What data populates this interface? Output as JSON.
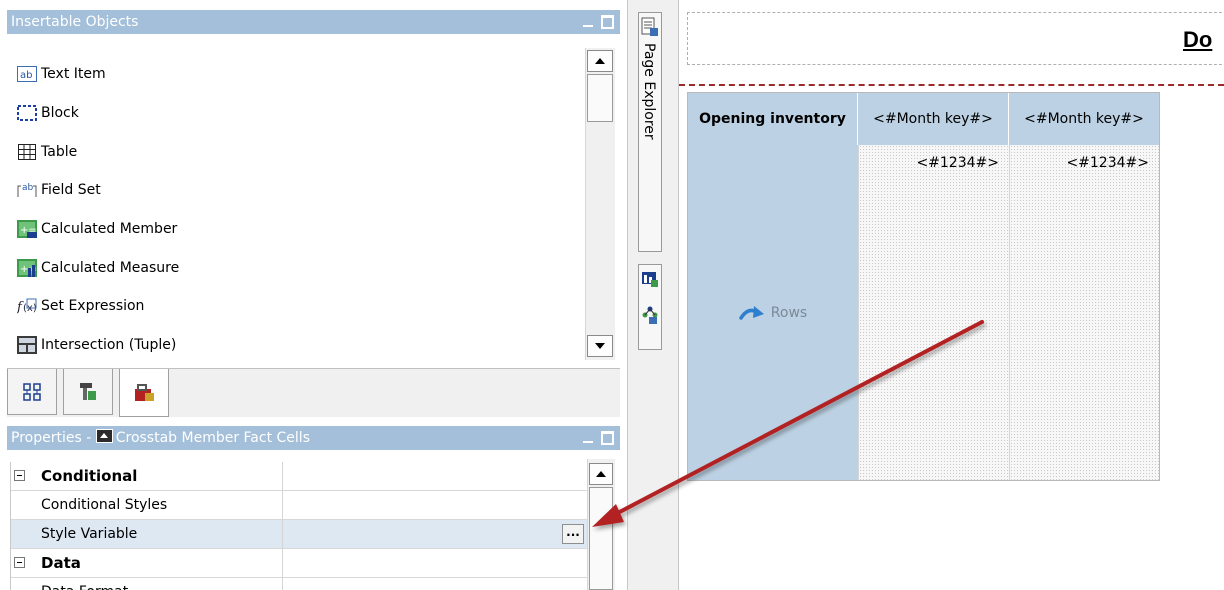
{
  "insertable_objects": {
    "title": "Insertable Objects",
    "items": [
      {
        "label": "Text Item",
        "icon": "text-item-icon"
      },
      {
        "label": "Block",
        "icon": "block-icon"
      },
      {
        "label": "Table",
        "icon": "table-icon"
      },
      {
        "label": "Field Set",
        "icon": "field-set-icon"
      },
      {
        "label": "Calculated Member",
        "icon": "calculated-member-icon"
      },
      {
        "label": "Calculated Measure",
        "icon": "calculated-measure-icon"
      },
      {
        "label": "Set Expression",
        "icon": "set-expression-icon"
      },
      {
        "label": "Intersection (Tuple)",
        "icon": "intersection-icon"
      }
    ],
    "tabs": [
      "source-tab-icon",
      "data-items-tab-icon",
      "toolbox-tab-icon"
    ]
  },
  "properties": {
    "title_prefix": "Properties - ",
    "title_object": "Crosstab Member Fact Cells",
    "rows": [
      {
        "name": "Conditional",
        "group": true
      },
      {
        "name": "Conditional Styles",
        "group": false
      },
      {
        "name": "Style Variable",
        "group": false
      },
      {
        "name": "Data",
        "group": true
      },
      {
        "name": "Data Format",
        "group": false
      }
    ],
    "ellipsis": "..."
  },
  "rail": {
    "page_explorer": "Page Explorer"
  },
  "canvas": {
    "title": "Do",
    "crosstab": {
      "corner": "Opening inventory",
      "columns": [
        "<#Month key#>",
        "<#Month key#>"
      ],
      "rows_label": "Rows",
      "facts": [
        "<#1234#>",
        "<#1234#>"
      ]
    }
  },
  "colors": {
    "panel_title": "#a3bfd9",
    "crosstab_header": "#bcd1e3",
    "arrow": "#b22222"
  }
}
